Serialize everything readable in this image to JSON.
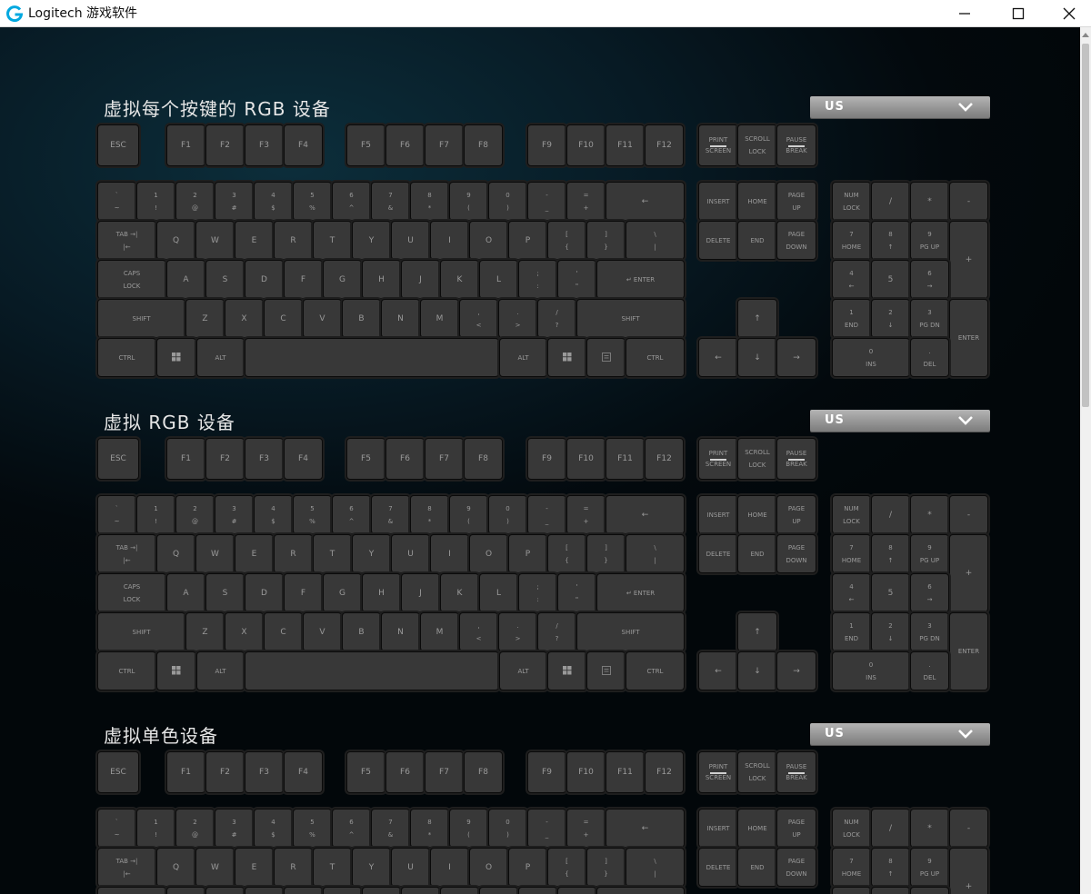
{
  "window": {
    "title": "Logitech 游戏软件"
  },
  "colors": {
    "background": "#02080c",
    "key": "#383838",
    "key_text": "#9a9a9a",
    "dropdown": "#9a9a9a"
  },
  "sections": [
    {
      "title": "虚拟每个按键的 RGB 设备",
      "layout": "US"
    },
    {
      "title": "虚拟 RGB 设备",
      "layout": "US"
    },
    {
      "title": "虚拟单色设备",
      "layout": "US"
    }
  ],
  "keys": {
    "esc": "ESC",
    "f1": "F1",
    "f2": "F2",
    "f3": "F3",
    "f4": "F4",
    "f5": "F5",
    "f6": "F6",
    "f7": "F7",
    "f8": "F8",
    "f9": "F9",
    "f10": "F10",
    "f11": "F11",
    "f12": "F12",
    "prtsc_1": "PRINT",
    "prtsc_2": "SCREEN",
    "scroll_1": "SCROLL",
    "scroll_2": "LOCK",
    "pause_1": "PAUSE",
    "pause_2": "BREAK",
    "grave_top": "`",
    "grave_bot": "~",
    "n1_top": "1",
    "n1_bot": "!",
    "n2_top": "2",
    "n2_bot": "@",
    "n3_top": "3",
    "n3_bot": "#",
    "n4_top": "4",
    "n4_bot": "$",
    "n5_top": "5",
    "n5_bot": "%",
    "n6_top": "6",
    "n6_bot": "^",
    "n7_top": "7",
    "n7_bot": "&",
    "n8_top": "8",
    "n8_bot": "*",
    "n9_top": "9",
    "n9_bot": "(",
    "n0_top": "0",
    "n0_bot": ")",
    "minus_top": "-",
    "minus_bot": "_",
    "equal_top": "=",
    "equal_bot": "+",
    "backspace": "←",
    "tab_1": "TAB →|",
    "tab_2": "|←",
    "q": "Q",
    "w": "W",
    "e": "E",
    "r": "R",
    "t": "T",
    "y": "Y",
    "u": "U",
    "i": "I",
    "o": "O",
    "p": "P",
    "lbracket_top": "[",
    "lbracket_bot": "{",
    "rbracket_top": "]",
    "rbracket_bot": "}",
    "backslash_top": "\\",
    "backslash_bot": "|",
    "caps_1": "CAPS",
    "caps_2": "LOCK",
    "a": "A",
    "s": "S",
    "d": "D",
    "f": "F",
    "g": "G",
    "h": "H",
    "j": "J",
    "k": "K",
    "l": "L",
    "semicolon_top": ";",
    "semicolon_bot": ":",
    "quote_top": "'",
    "quote_bot": "\"",
    "enter": "↵ ENTER",
    "shift": "SHIFT",
    "z": "Z",
    "x": "X",
    "c": "C",
    "v": "V",
    "b": "B",
    "n": "N",
    "m": "M",
    "comma_top": ",",
    "comma_bot": "<",
    "period_top": ".",
    "period_bot": ">",
    "slash_top": "/",
    "slash_bot": "?",
    "ctrl": "CTRL",
    "alt": "ALT",
    "insert": "INSERT",
    "home": "HOME",
    "pgup_1": "PAGE",
    "pgup_2": "UP",
    "delete": "DELETE",
    "end": "END",
    "pgdn_1": "PAGE",
    "pgdn_2": "DOWN",
    "up": "↑",
    "left": "←",
    "down": "↓",
    "right": "→",
    "numlock_1": "NUM",
    "numlock_2": "LOCK",
    "np_div": "/",
    "np_mul": "*",
    "np_sub": "-",
    "np_add": "+",
    "np7": "7",
    "np7_sub": "HOME",
    "np8": "8",
    "np8_sub": "↑",
    "np9": "9",
    "np9_sub": "PG UP",
    "np4": "4",
    "np4_sub": "←",
    "np5": "5",
    "np6": "6",
    "np6_sub": "→",
    "np1": "1",
    "np1_sub": "END",
    "np2": "2",
    "np2_sub": "↓",
    "np3": "3",
    "np3_sub": "PG DN",
    "np0": "0",
    "np0_sub": "INS",
    "npdot": ".",
    "npdot_sub": "DEL",
    "np_enter": "ENTER"
  }
}
